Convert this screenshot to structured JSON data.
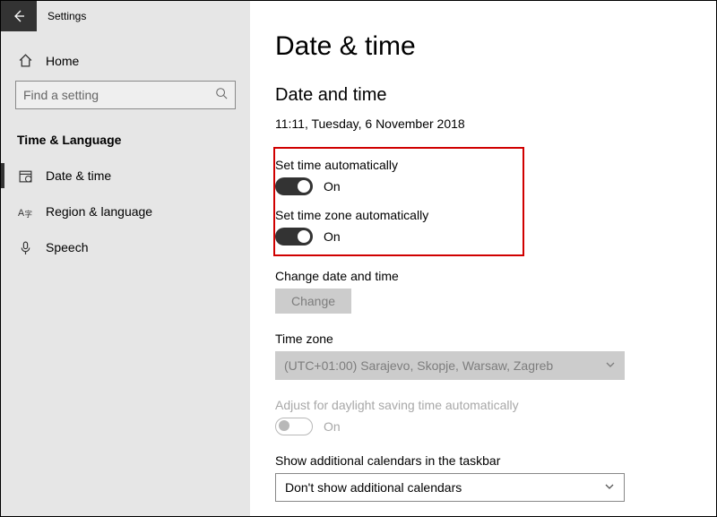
{
  "window": {
    "title": "Settings"
  },
  "sidebar": {
    "home_label": "Home",
    "search_placeholder": "Find a setting",
    "section_title": "Time & Language",
    "items": [
      {
        "label": "Date & time"
      },
      {
        "label": "Region & language"
      },
      {
        "label": "Speech"
      }
    ]
  },
  "main": {
    "page_title": "Date & time",
    "subheading": "Date and time",
    "current_datetime": "11:11, Tuesday, 6 November 2018",
    "set_time_auto": {
      "label": "Set time automatically",
      "state": "On"
    },
    "set_tz_auto": {
      "label": "Set time zone automatically",
      "state": "On"
    },
    "change": {
      "label": "Change date and time",
      "button": "Change"
    },
    "timezone": {
      "label": "Time zone",
      "value": "(UTC+01:00) Sarajevo, Skopje, Warsaw, Zagreb"
    },
    "dst": {
      "label": "Adjust for daylight saving time automatically",
      "state": "On"
    },
    "calendars": {
      "label": "Show additional calendars in the taskbar",
      "value": "Don't show additional calendars"
    }
  }
}
